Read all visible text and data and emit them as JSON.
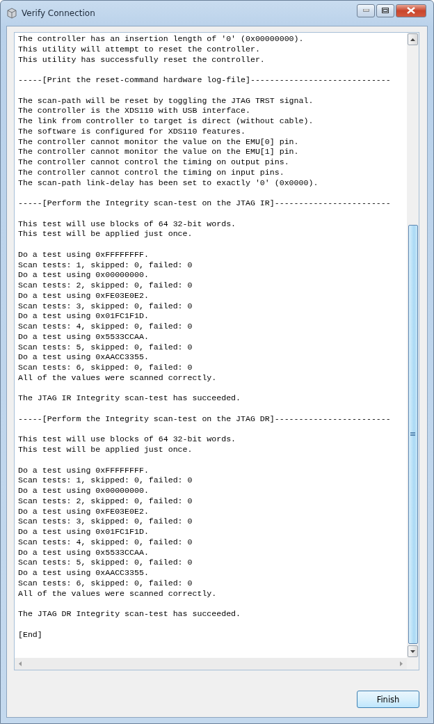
{
  "window": {
    "title": "Verify Connection"
  },
  "log": [
    [
      "The controller has an insertion length of '0' (0x00000000).",
      "This utility will attempt to reset the controller.",
      "This utility has successfully reset the controller."
    ],
    [
      "-----[Print the reset-command hardware log-file]-----------------------------"
    ],
    [
      "The scan-path will be reset by toggling the JTAG TRST signal.",
      "The controller is the XDS110 with USB interface.",
      "The link from controller to target is direct (without cable).",
      "The software is configured for XDS110 features.",
      "The controller cannot monitor the value on the EMU[0] pin.",
      "The controller cannot monitor the value on the EMU[1] pin.",
      "The controller cannot control the timing on output pins.",
      "The controller cannot control the timing on input pins.",
      "The scan-path link-delay has been set to exactly '0' (0x0000)."
    ],
    [
      "-----[Perform the Integrity scan-test on the JTAG IR]------------------------"
    ],
    [
      "This test will use blocks of 64 32-bit words.",
      "This test will be applied just once."
    ],
    [
      "Do a test using 0xFFFFFFFF.",
      "Scan tests: 1, skipped: 0, failed: 0",
      "Do a test using 0x00000000.",
      "Scan tests: 2, skipped: 0, failed: 0",
      "Do a test using 0xFE03E0E2.",
      "Scan tests: 3, skipped: 0, failed: 0",
      "Do a test using 0x01FC1F1D.",
      "Scan tests: 4, skipped: 0, failed: 0",
      "Do a test using 0x5533CCAA.",
      "Scan tests: 5, skipped: 0, failed: 0",
      "Do a test using 0xAACC3355.",
      "Scan tests: 6, skipped: 0, failed: 0",
      "All of the values were scanned correctly."
    ],
    [
      "The JTAG IR Integrity scan-test has succeeded."
    ],
    [
      "-----[Perform the Integrity scan-test on the JTAG DR]------------------------"
    ],
    [
      "This test will use blocks of 64 32-bit words.",
      "This test will be applied just once."
    ],
    [
      "Do a test using 0xFFFFFFFF.",
      "Scan tests: 1, skipped: 0, failed: 0",
      "Do a test using 0x00000000.",
      "Scan tests: 2, skipped: 0, failed: 0",
      "Do a test using 0xFE03E0E2.",
      "Scan tests: 3, skipped: 0, failed: 0",
      "Do a test using 0x01FC1F1D.",
      "Scan tests: 4, skipped: 0, failed: 0",
      "Do a test using 0x5533CCAA.",
      "Scan tests: 5, skipped: 0, failed: 0",
      "Do a test using 0xAACC3355.",
      "Scan tests: 6, skipped: 0, failed: 0",
      "All of the values were scanned correctly."
    ],
    [
      "The JTAG DR Integrity scan-test has succeeded."
    ],
    [
      "[End]"
    ]
  ],
  "buttons": [
    "Finish"
  ]
}
